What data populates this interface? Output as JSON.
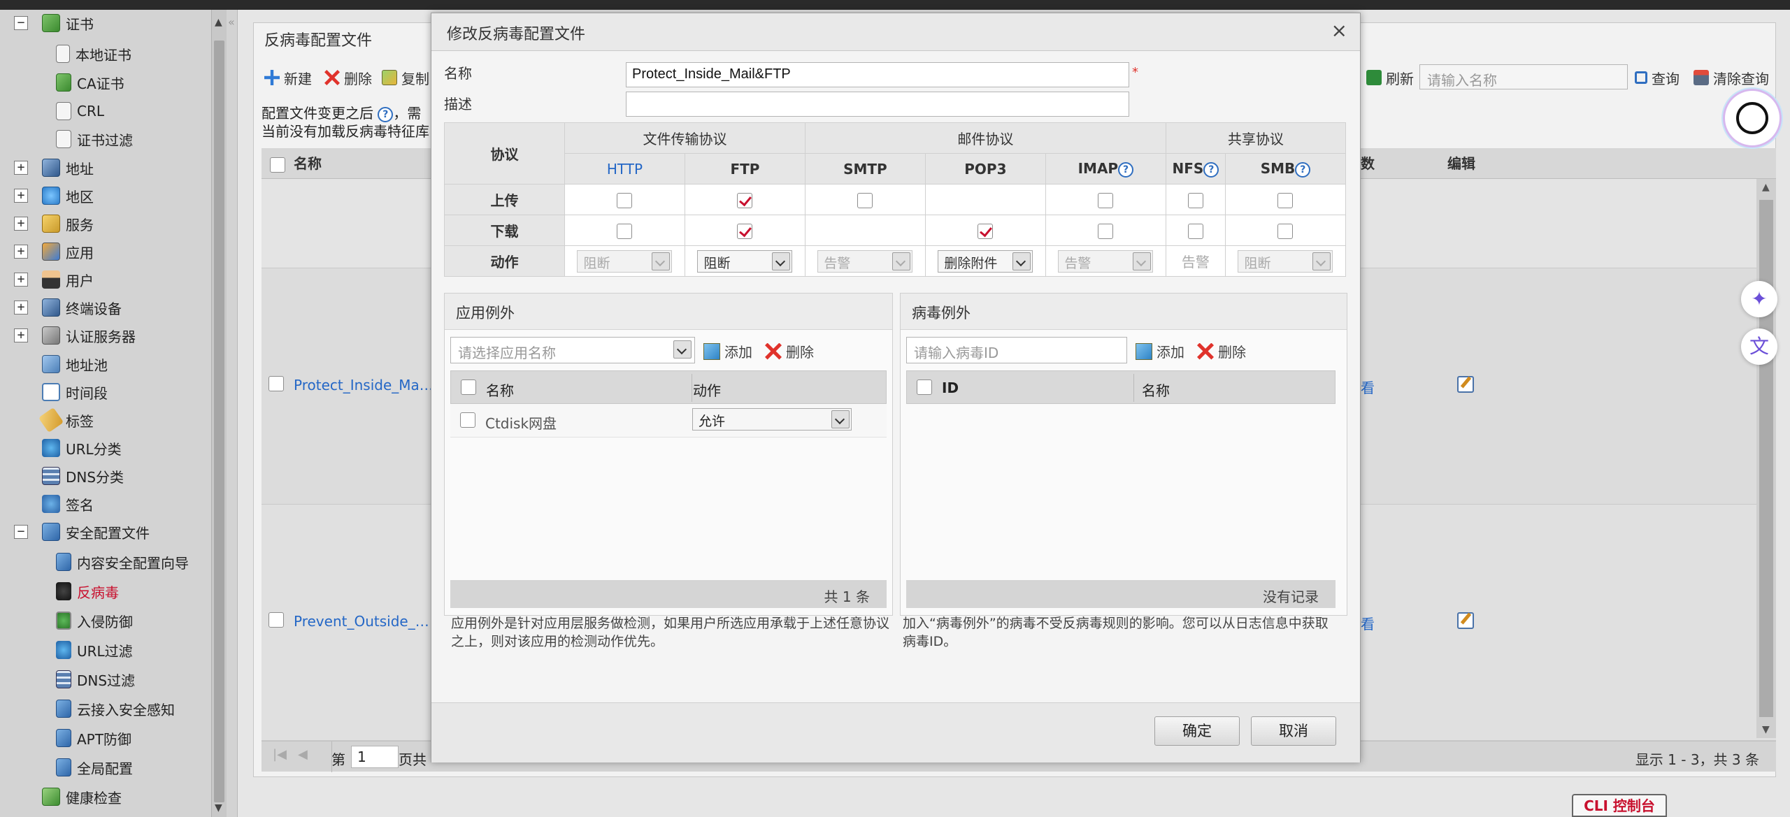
{
  "sidebar": {
    "items": [
      {
        "label": "证书",
        "name": "sidebar-item-certificate"
      },
      {
        "label": "本地证书",
        "name": "sidebar-item-local-cert"
      },
      {
        "label": "CA证书",
        "name": "sidebar-item-ca-cert"
      },
      {
        "label": "CRL",
        "name": "sidebar-item-crl"
      },
      {
        "label": "证书过滤",
        "name": "sidebar-item-cert-filter"
      },
      {
        "label": "地址",
        "name": "sidebar-item-address"
      },
      {
        "label": "地区",
        "name": "sidebar-item-region"
      },
      {
        "label": "服务",
        "name": "sidebar-item-service"
      },
      {
        "label": "应用",
        "name": "sidebar-item-application"
      },
      {
        "label": "用户",
        "name": "sidebar-item-user"
      },
      {
        "label": "终端设备",
        "name": "sidebar-item-terminal"
      },
      {
        "label": "认证服务器",
        "name": "sidebar-item-auth-server"
      },
      {
        "label": "地址池",
        "name": "sidebar-item-address-pool"
      },
      {
        "label": "时间段",
        "name": "sidebar-item-schedule"
      },
      {
        "label": "标签",
        "name": "sidebar-item-tag"
      },
      {
        "label": "URL分类",
        "name": "sidebar-item-url-category"
      },
      {
        "label": "DNS分类",
        "name": "sidebar-item-dns-category"
      },
      {
        "label": "签名",
        "name": "sidebar-item-signature"
      },
      {
        "label": "安全配置文件",
        "name": "sidebar-item-security-profile"
      },
      {
        "label": "内容安全配置向导",
        "name": "sidebar-item-content-wizard"
      },
      {
        "label": "反病毒",
        "name": "sidebar-item-antivirus"
      },
      {
        "label": "入侵防御",
        "name": "sidebar-item-ips"
      },
      {
        "label": "URL过滤",
        "name": "sidebar-item-url-filter"
      },
      {
        "label": "DNS过滤",
        "name": "sidebar-item-dns-filter"
      },
      {
        "label": "云接入安全感知",
        "name": "sidebar-item-cloud-access"
      },
      {
        "label": "APT防御",
        "name": "sidebar-item-apt"
      },
      {
        "label": "全局配置",
        "name": "sidebar-item-global-config"
      },
      {
        "label": "健康检查",
        "name": "sidebar-item-health-check"
      }
    ],
    "expanders": {
      "minus": "−",
      "plus": "+"
    }
  },
  "panel": {
    "title": "反病毒配置文件",
    "toolbar": {
      "new": "新建",
      "delete": "删除",
      "copy": "复制",
      "refresh": "刷新",
      "query": "查询",
      "clear_query": "清除查询"
    },
    "search_placeholder": "请输入名称",
    "info_line1": "配置文件变更之后",
    "info_line1_tail": "，需",
    "info_line2": "当前没有加载反病毒特征库",
    "columns": {
      "name": "名称",
      "count": "数",
      "edit": "编辑"
    },
    "rows": [
      {
        "name": "Protect_Inside_Ma…",
        "view": "看"
      },
      {
        "name": "Prevent_Outside_…",
        "view": "看"
      }
    ],
    "pager": {
      "page_prefix": "第",
      "page": "1",
      "page_suffix": "页共",
      "summary": "显示 1 - 3，共 3 条"
    },
    "cli": "CLI 控制台"
  },
  "modal": {
    "title": "修改反病毒配置文件",
    "close": "×",
    "name_label": "名称",
    "name_value": "Protect_Inside_Mail&FTP",
    "required_mark": "*",
    "desc_label": "描述",
    "desc_value": "",
    "protocol": {
      "col_protocol": "协议",
      "groups": {
        "file": "文件传输协议",
        "mail": "邮件协议",
        "share": "共享协议"
      },
      "protocols": [
        "HTTP",
        "FTP",
        "SMTP",
        "POP3",
        "IMAP",
        "NFS",
        "SMB"
      ],
      "rows": {
        "upload": "上传",
        "download": "下载",
        "action": "动作"
      },
      "actions": {
        "http": "阻断",
        "ftp": "阻断",
        "smtp": "告警",
        "pop3": "删除附件",
        "imap": "告警",
        "nfs": "告警",
        "smb": "阻断"
      }
    },
    "app_exception": {
      "title": "应用例外",
      "select_placeholder": "请选择应用名称",
      "add": "添加",
      "delete": "删除",
      "col_name": "名称",
      "col_action": "动作",
      "rows": [
        {
          "name": "Ctdisk网盘",
          "action": "允许"
        }
      ],
      "footer": "共 1 条",
      "note": "应用例外是针对应用层服务做检测，如果用户所选应用承载于上述任意协议之上，则对该应用的检测动作优先。"
    },
    "virus_exception": {
      "title": "病毒例外",
      "input_placeholder": "请输入病毒ID",
      "add": "添加",
      "delete": "删除",
      "col_id": "ID",
      "col_name": "名称",
      "footer": "没有记录",
      "note": "加入“病毒例外”的病毒不受反病毒规则的影响。您可以从日志信息中获取病毒ID。"
    },
    "ok": "确定",
    "cancel": "取消"
  },
  "colors": {
    "accent": "#2467c6",
    "danger": "#c8102e",
    "header_bg": "#e6e6e6"
  }
}
